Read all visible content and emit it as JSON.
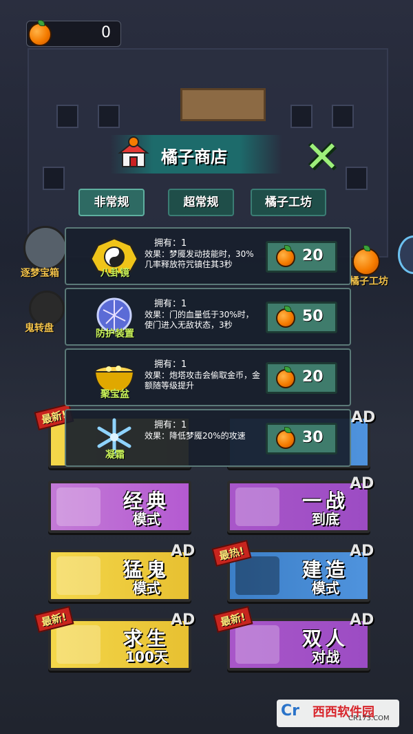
{
  "counter": {
    "value": "0",
    "icon": "orange-icon"
  },
  "shop": {
    "title": "橘子商店"
  },
  "tabs": [
    {
      "label": "非常规"
    },
    {
      "label": "超常规"
    },
    {
      "label": "橘子工坊"
    }
  ],
  "items": [
    {
      "name": "八卦镜",
      "own": "拥有：1",
      "effect": "效果：梦魇发动技能时，30%几率释放符咒镇住其3秒",
      "price": "20",
      "icon": "bagua-mirror-icon"
    },
    {
      "name": "防护装置",
      "own": "拥有：1",
      "effect": "效果：门的血量低于30%时，使门进入无敌状态，3秒",
      "price": "50",
      "icon": "shield-orb-icon"
    },
    {
      "name": "聚宝盆",
      "own": "拥有：1",
      "effect": "效果：炮塔攻击会偷取金币，金额随等级提升",
      "price": "20",
      "icon": "treasure-bowl-icon"
    },
    {
      "name": "凝霜",
      "own": "拥有：1",
      "effect": "效果：降低梦魇20%的攻速",
      "price": "30",
      "icon": "snowflake-icon"
    }
  ],
  "side": {
    "left1": "逐梦宝箱",
    "left2": "鬼转盘",
    "right1": "橘子工坊"
  },
  "modes": [
    {
      "line1": "经典",
      "line2": "模式",
      "ad": "",
      "badge": ""
    },
    {
      "line1": "一战",
      "line2": "到底",
      "ad": "AD",
      "badge": ""
    },
    {
      "line1": "猛鬼",
      "line2": "模式",
      "ad": "AD",
      "badge": ""
    },
    {
      "line1": "建造",
      "line2": "模式",
      "ad": "AD",
      "badge": "最热!"
    },
    {
      "line1": "求生",
      "line2": "100天",
      "ad": "AD",
      "badge": "最新!"
    },
    {
      "line1": "双人",
      "line2": "对战",
      "ad": "AD",
      "badge": "最新!"
    }
  ],
  "hidden_row": {
    "badge": "最新!",
    "ad": "AD"
  },
  "watermark": {
    "logo": "Cr",
    "name": "西西软件园",
    "url": "CR173.COM"
  },
  "colors": {
    "accent": "#c8f25a",
    "panel": "#1d6b6b",
    "price_bg": "#3f7c6c"
  }
}
